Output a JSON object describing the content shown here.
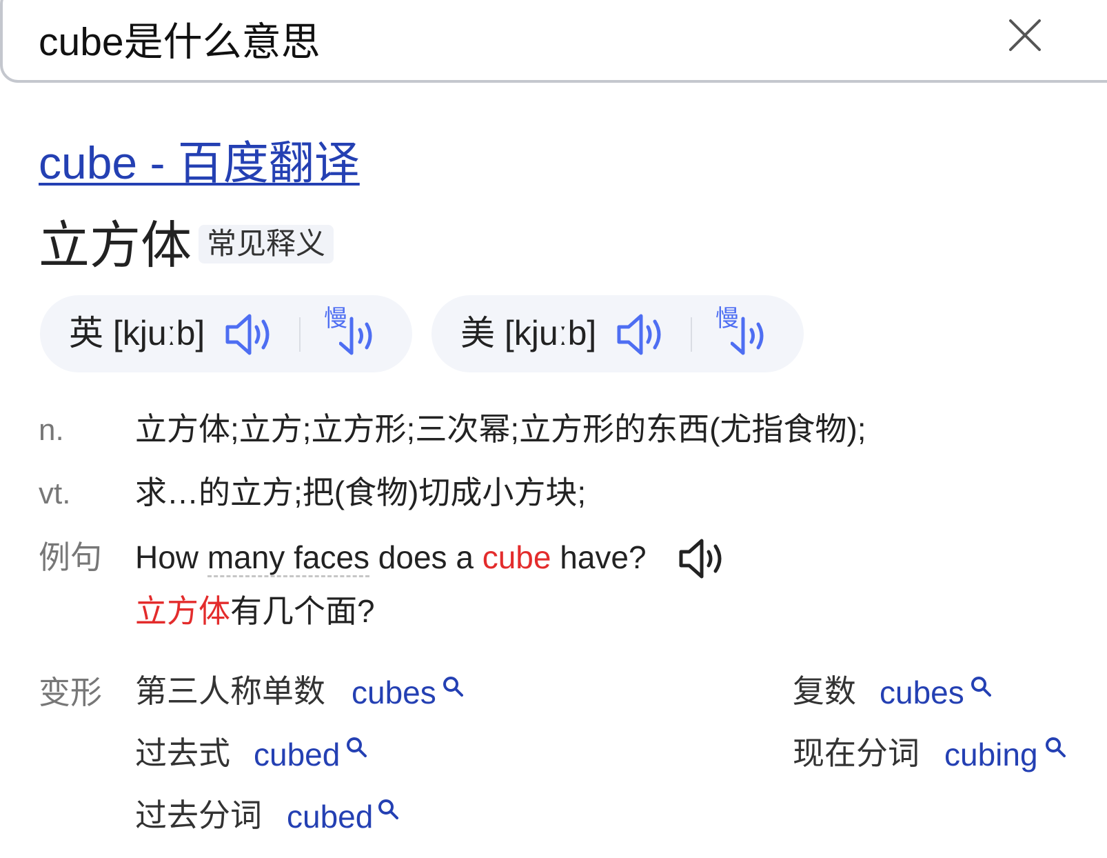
{
  "search": {
    "query": "cube是什么意思"
  },
  "result": {
    "title": "cube - 百度翻译",
    "headword": "立方体",
    "badge": "常见释义"
  },
  "pronunciation": {
    "uk": {
      "label": "英 [kjuːb]"
    },
    "us": {
      "label": "美 [kjuːb]"
    },
    "slow_char": "慢"
  },
  "definitions": [
    {
      "pos": "n.",
      "text": "立方体;立方;立方形;三次幂;立方形的东西(尤指食物);"
    },
    {
      "pos": "vt.",
      "text": "求…的立方;把(食物)切成小方块;"
    }
  ],
  "example": {
    "label": "例句",
    "en_before": "How ",
    "en_dotted": "many faces",
    "en_mid": " does a ",
    "en_highlight": "cube",
    "en_after": " have?",
    "zh_highlight": "立方体",
    "zh_after": "有几个面?"
  },
  "forms": {
    "label": "变形",
    "items": [
      {
        "label": "第三人称单数",
        "word": "cubes"
      },
      {
        "label": "复数",
        "word": "cubes"
      },
      {
        "label": "过去式",
        "word": "cubed"
      },
      {
        "label": "现在分词",
        "word": "cubing"
      },
      {
        "label": "过去分词",
        "word": "cubed"
      }
    ]
  },
  "colors": {
    "link": "#2440b3",
    "highlight": "#e32c2c",
    "accent_icon": "#4e6ef2",
    "pill_bg": "#f3f5fa"
  }
}
